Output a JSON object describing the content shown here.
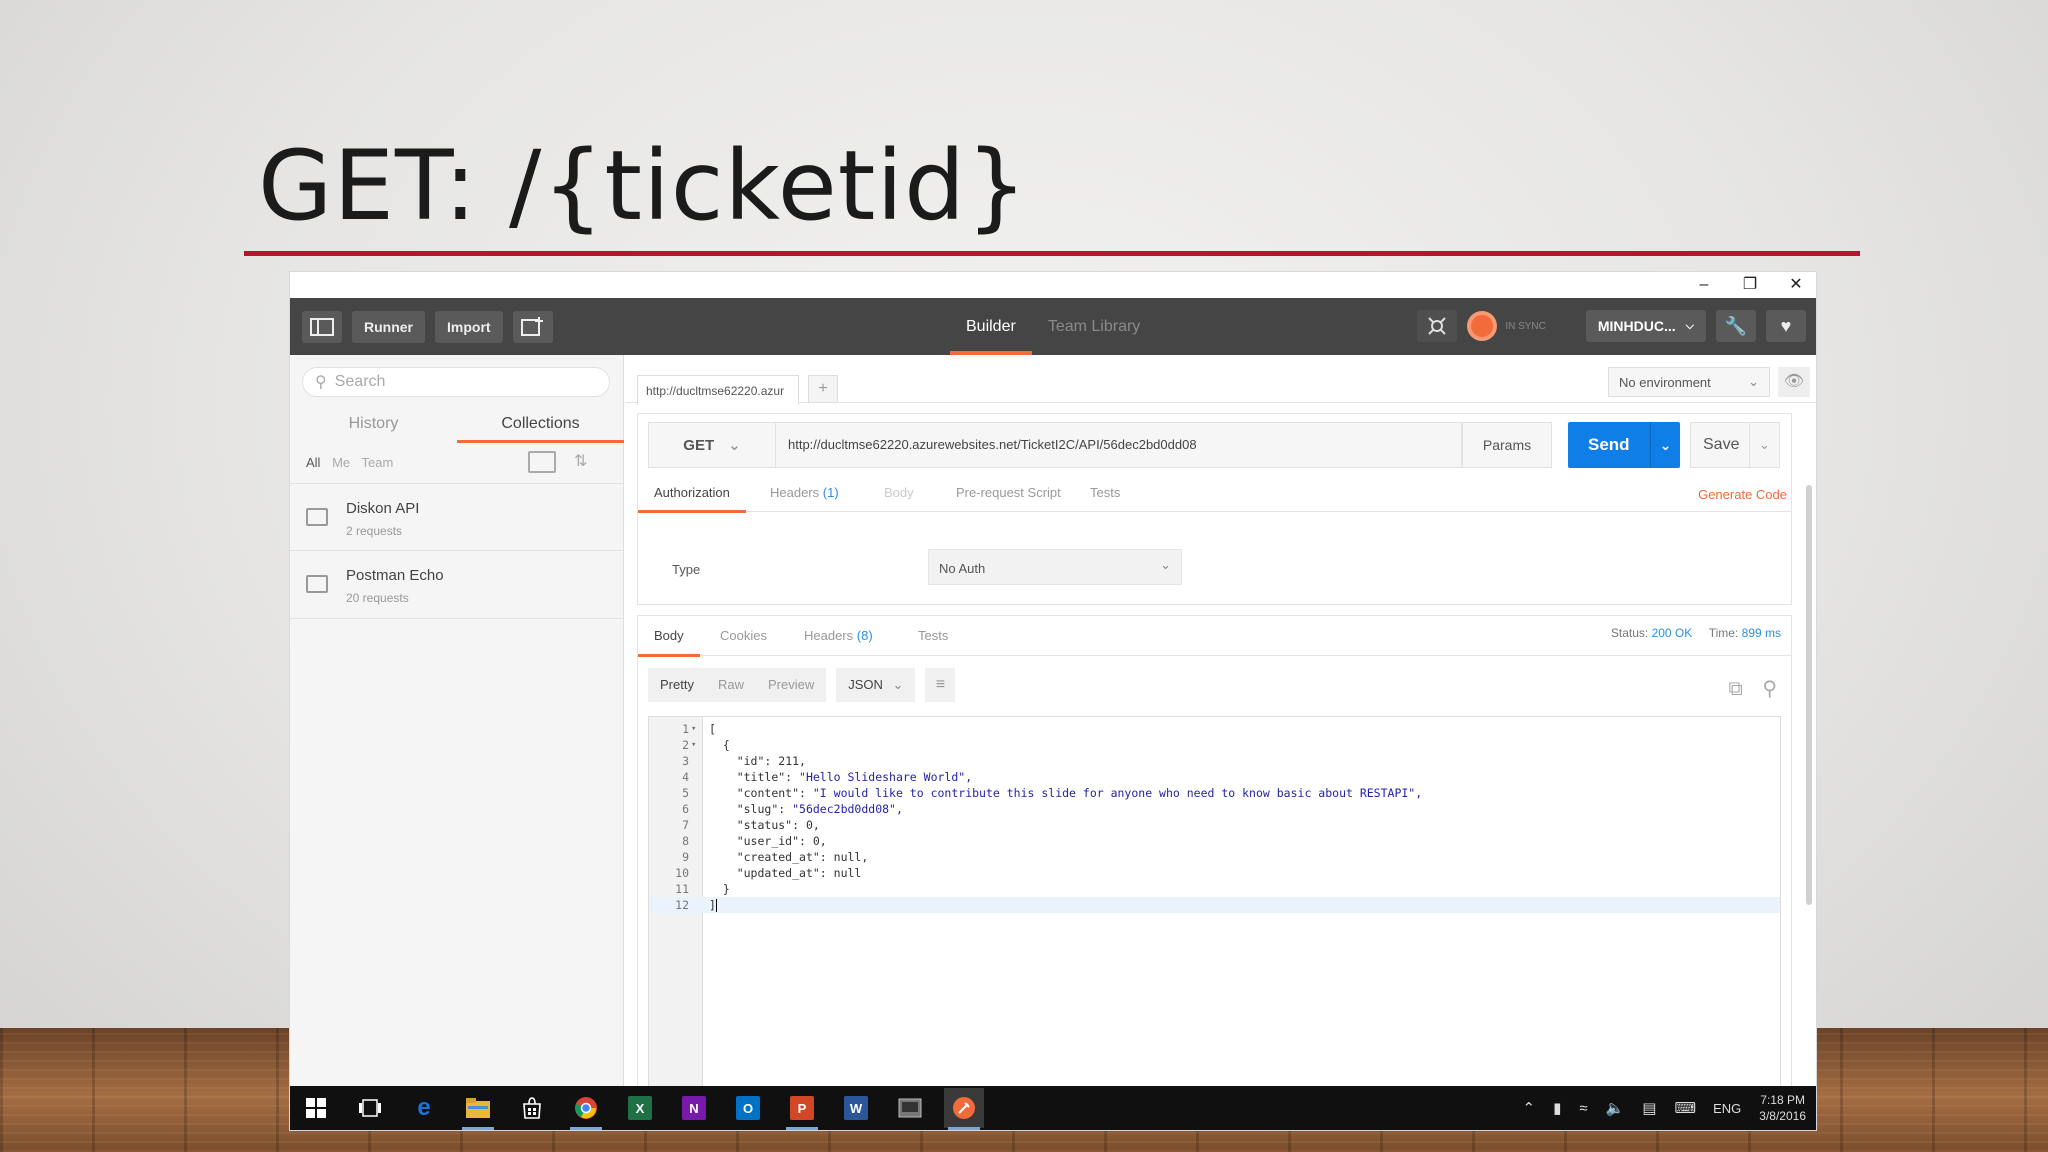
{
  "slide": {
    "title": "GET: /{ticketid}",
    "accent_color": "#b5162b"
  },
  "window": {
    "controls": [
      "minimize-icon",
      "restore-icon",
      "close-icon"
    ]
  },
  "topbar": {
    "runner_label": "Runner",
    "import_label": "Import",
    "tabs": [
      {
        "label": "Builder",
        "active": true
      },
      {
        "label": "Team Library",
        "active": false
      }
    ],
    "sync_label": "IN SYNC",
    "user_label": "MINHDUC...",
    "accent_color": "#f26b3a"
  },
  "sidebar": {
    "search_placeholder": "Search",
    "tabs": [
      {
        "label": "History",
        "active": false
      },
      {
        "label": "Collections",
        "active": true
      }
    ],
    "filters": [
      "All",
      "Me",
      "Team"
    ],
    "collections": [
      {
        "name": "Diskon API",
        "count": "2 requests"
      },
      {
        "name": "Postman Echo",
        "count": "20 requests"
      }
    ]
  },
  "request": {
    "tab_label": "http://ducltmse62220.azur",
    "environment": "No environment",
    "method": "GET",
    "url": "http://ducltmse62220.azurewebsites.net/TicketI2C/API/56dec2bd0dd08",
    "params_label": "Params",
    "send_label": "Send",
    "save_label": "Save",
    "send_color": "#0f7ee6",
    "tabs": {
      "authorization": "Authorization",
      "headers": "Headers",
      "headers_count": "(1)",
      "body": "Body",
      "prerequest": "Pre-request Script",
      "tests": "Tests"
    },
    "generate_code": "Generate Code",
    "auth_type_label": "Type",
    "auth_type_value": "No Auth"
  },
  "response": {
    "tabs": {
      "body": "Body",
      "cookies": "Cookies",
      "headers": "Headers",
      "headers_count": "(8)",
      "tests": "Tests"
    },
    "status_label": "Status:",
    "status_value": "200 OK",
    "time_label": "Time:",
    "time_value": "899 ms",
    "format_tabs": [
      "Pretty",
      "Raw",
      "Preview"
    ],
    "format_select": "JSON",
    "code_lines": [
      {
        "n": "1",
        "text": "["
      },
      {
        "n": "2",
        "text": "  {"
      },
      {
        "n": "3",
        "key": "\"id\"",
        "val": "211,",
        "type": "num",
        "indent": "    "
      },
      {
        "n": "4",
        "key": "\"title\"",
        "val": "\"Hello Slideshare World\",",
        "type": "str",
        "indent": "    "
      },
      {
        "n": "5",
        "key": "\"content\"",
        "val": "\"I would like to contribute this slide for anyone who need to know basic about RESTAPI\",",
        "type": "str",
        "indent": "    "
      },
      {
        "n": "6",
        "key": "\"slug\"",
        "val": "\"56dec2bd0dd08\",",
        "type": "str",
        "indent": "    "
      },
      {
        "n": "7",
        "key": "\"status\"",
        "val": "0,",
        "type": "num",
        "indent": "    "
      },
      {
        "n": "8",
        "key": "\"user_id\"",
        "val": "0,",
        "type": "num",
        "indent": "    "
      },
      {
        "n": "9",
        "key": "\"created_at\"",
        "val": "null,",
        "type": "num",
        "indent": "    "
      },
      {
        "n": "10",
        "key": "\"updated_at\"",
        "val": "null",
        "type": "num",
        "indent": "    "
      },
      {
        "n": "11",
        "text": "  }"
      },
      {
        "n": "12",
        "text": "]"
      }
    ]
  },
  "taskbar": {
    "apps": [
      {
        "name": "windows-start-icon",
        "letter": "",
        "color": "#ffffff"
      },
      {
        "name": "task-view-icon",
        "letter": "",
        "color": "#ffffff"
      },
      {
        "name": "edge-icon",
        "letter": "e",
        "color": "#1a73d9"
      },
      {
        "name": "file-explorer-icon",
        "letter": "",
        "color": "#e8b63a"
      },
      {
        "name": "store-icon",
        "letter": "",
        "color": "#ffffff"
      },
      {
        "name": "chrome-icon",
        "letter": "",
        "color": "#e0b42f"
      },
      {
        "name": "excel-icon",
        "letter": "X",
        "color": "#1e7145"
      },
      {
        "name": "onenote-icon",
        "letter": "N",
        "color": "#7719aa"
      },
      {
        "name": "outlook-icon",
        "letter": "O",
        "color": "#0072c6"
      },
      {
        "name": "powerpoint-icon",
        "letter": "P",
        "color": "#d24726"
      },
      {
        "name": "word-icon",
        "letter": "W",
        "color": "#2b579a"
      },
      {
        "name": "app-icon",
        "letter": "",
        "color": "#888888"
      },
      {
        "name": "postman-icon",
        "letter": "",
        "color": "#f26b3a"
      }
    ],
    "language": "ENG",
    "time": "7:18 PM",
    "date": "3/8/2016"
  }
}
